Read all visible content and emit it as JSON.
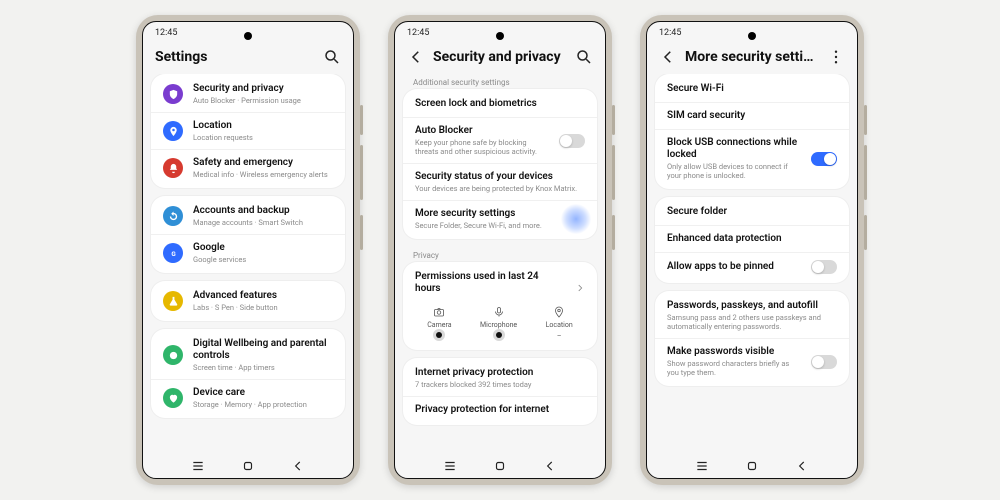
{
  "status": {
    "time": "12:45"
  },
  "colors": {
    "purple": "#7a3ccf",
    "blue": "#2f6bff",
    "red": "#d63a2f",
    "teal": "#2f8fd6",
    "google": "#2f6bff",
    "yellow": "#e6b800",
    "green": "#2fb56a",
    "gray": "#8a8a8a"
  },
  "phone1": {
    "title": "Settings",
    "groups": [
      [
        {
          "key": "security",
          "title": "Security and privacy",
          "sub": "Auto Blocker  ·  Permission usage",
          "color": "purple",
          "icon": "shield"
        },
        {
          "key": "location",
          "title": "Location",
          "sub": "Location requests",
          "color": "blue",
          "icon": "pin"
        },
        {
          "key": "safety",
          "title": "Safety and emergency",
          "sub": "Medical info  ·  Wireless emergency alerts",
          "color": "red",
          "icon": "bell"
        }
      ],
      [
        {
          "key": "accounts",
          "title": "Accounts and backup",
          "sub": "Manage accounts  ·  Smart Switch",
          "color": "teal",
          "icon": "sync"
        },
        {
          "key": "google",
          "title": "Google",
          "sub": "Google services",
          "color": "google",
          "icon": "g"
        }
      ],
      [
        {
          "key": "advanced",
          "title": "Advanced features",
          "sub": "Labs  ·  S Pen  ·  Side button",
          "color": "yellow",
          "icon": "flask"
        }
      ],
      [
        {
          "key": "wellbeing",
          "title": "Digital Wellbeing and parental controls",
          "sub": "Screen time  ·  App timers",
          "color": "green",
          "icon": "circle"
        },
        {
          "key": "devicecare",
          "title": "Device care",
          "sub": "Storage  ·  Memory  ·  App protection",
          "color": "green",
          "icon": "heart"
        }
      ]
    ]
  },
  "phone2": {
    "title": "Security and privacy",
    "section1_label": "Additional security settings",
    "rows1": [
      {
        "key": "screenlock",
        "title": "Screen lock and biometrics",
        "sub": ""
      },
      {
        "key": "autoblocker",
        "title": "Auto Blocker",
        "sub": "Keep your phone safe by blocking threats and other suspicious activity.",
        "toggle": true,
        "toggle_on": false
      },
      {
        "key": "securitystatus",
        "title": "Security status of your devices",
        "sub": "Your devices are being protected by Knox Matrix."
      },
      {
        "key": "moresecurity",
        "title": "More security settings",
        "sub": "Secure Folder, Secure Wi-Fi, and more.",
        "ripple": true
      }
    ],
    "privacy_label": "Privacy",
    "permissions_title": "Permissions used in last 24 hours",
    "perms": [
      {
        "label": "Camera",
        "icon": "camera",
        "active": true
      },
      {
        "label": "Microphone",
        "icon": "mic",
        "active": true
      },
      {
        "label": "Location",
        "icon": "pin",
        "active": false,
        "value": "–"
      }
    ],
    "rows_privacy": [
      {
        "key": "internetprivacy",
        "title": "Internet privacy protection",
        "sub": "7 trackers blocked 392 times today"
      },
      {
        "key": "privacyinternet",
        "title": "Privacy protection for internet",
        "sub": ""
      }
    ]
  },
  "phone3": {
    "title": "More security settings",
    "groups": [
      [
        {
          "key": "securewifi",
          "title": "Secure Wi-Fi"
        },
        {
          "key": "simsecurity",
          "title": "SIM card security"
        },
        {
          "key": "blockusb",
          "title": "Block USB connections while locked",
          "sub": "Only allow USB devices to connect if your phone is unlocked.",
          "toggle": true,
          "toggle_on": true
        }
      ],
      [
        {
          "key": "securefolder",
          "title": "Secure folder"
        },
        {
          "key": "enhanced",
          "title": "Enhanced data protection"
        },
        {
          "key": "pinapps",
          "title": "Allow apps to be pinned",
          "toggle": true,
          "toggle_on": false
        }
      ],
      [
        {
          "key": "passwords",
          "title": "Passwords, passkeys, and autofill",
          "sub": "Samsung pass and 2 others use passkeys and automatically entering passwords."
        },
        {
          "key": "showpw",
          "title": "Make passwords visible",
          "sub": "Show password characters briefly as you type them.",
          "toggle": true,
          "toggle_on": false
        }
      ]
    ]
  }
}
